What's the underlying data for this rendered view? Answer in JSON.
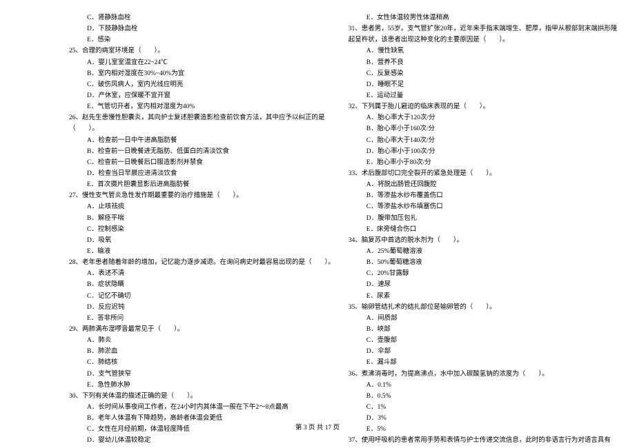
{
  "left_col": [
    {
      "type": "opt",
      "text": "C．肾静脉血栓"
    },
    {
      "type": "opt",
      "text": "D．下肢静脉血栓"
    },
    {
      "type": "opt",
      "text": "E．感染"
    },
    {
      "type": "q",
      "num": "25、",
      "text": "合理的病室环境是（　　）。"
    },
    {
      "type": "opt",
      "text": "A．婴儿室室温宜在22~24℃"
    },
    {
      "type": "opt",
      "text": "B．室内相对湿度在30%~40%为宜"
    },
    {
      "type": "opt",
      "text": "C．破伤风病人，室内光线应明亮"
    },
    {
      "type": "opt",
      "text": "D．产休室，应保暖不宜开窗"
    },
    {
      "type": "opt",
      "text": "E．气管切开者，室内相对湿度为40%"
    },
    {
      "type": "q",
      "num": "26、",
      "text": "赵先生患慢性胆囊炎，其向护士复述胆囊造影检查前饮食方法，其中应予以纠正的是"
    },
    {
      "type": "cont",
      "text": "（　　）。"
    },
    {
      "type": "opt",
      "text": "A．检查前一日中午进高脂肪餐"
    },
    {
      "type": "opt",
      "text": "B．检查前一日晚餐进无脂肪、低蛋白的清淡饮食"
    },
    {
      "type": "opt",
      "text": "C．检查前一日晚餐后口服造影剂并禁食"
    },
    {
      "type": "opt",
      "text": "D．检查当日早晨应进清淡饮食"
    },
    {
      "type": "opt",
      "text": "E．首次摄片胆囊显影后进高脂肪餐"
    },
    {
      "type": "q",
      "num": "27、",
      "text": "慢性支气管炎急性发作期最重要的治疗措施是（　　）。"
    },
    {
      "type": "opt",
      "text": "A．止咳祛痰"
    },
    {
      "type": "opt",
      "text": "B．解痉平喘"
    },
    {
      "type": "opt",
      "text": "C．控制感染"
    },
    {
      "type": "opt",
      "text": "D．吸氧"
    },
    {
      "type": "opt",
      "text": "E．输液"
    },
    {
      "type": "q",
      "num": "28、",
      "text": "老年患者随着年龄的增加，记忆能力逐步减退。在询问病史时最容易出现的是（　　）。"
    },
    {
      "type": "opt",
      "text": "A．表述不清"
    },
    {
      "type": "opt",
      "text": "B．症状隐瞒"
    },
    {
      "type": "opt",
      "text": "C．记忆不确切"
    },
    {
      "type": "opt",
      "text": "D．反应迟钝"
    },
    {
      "type": "opt",
      "text": "E．答非所问"
    },
    {
      "type": "q",
      "num": "29、",
      "text": "两肺满布湿啰音最常见于（　　）。"
    },
    {
      "type": "opt",
      "text": "A．肺炎"
    },
    {
      "type": "opt",
      "text": "B．肺淤血"
    },
    {
      "type": "opt",
      "text": "C．肺结核"
    },
    {
      "type": "opt",
      "text": "D．支气管狭窄"
    },
    {
      "type": "opt",
      "text": "E．急性肺水肿"
    },
    {
      "type": "q",
      "num": "30、",
      "text": "下列有关体温的描述正确的是（　　）。"
    },
    {
      "type": "opt",
      "text": "A．长时间从事夜间工作者，在24小时内其体温一般在下午2～8点最高"
    },
    {
      "type": "opt",
      "text": "B．老年人体温有下降趋势，高龄者体温会更低"
    },
    {
      "type": "opt",
      "text": "C．女性在月经前期，体温轻度降低"
    },
    {
      "type": "opt",
      "text": "D．婴幼儿体温较稳定"
    }
  ],
  "right_col": [
    {
      "type": "opt",
      "text": "E．女性体温较男性体温稍高"
    },
    {
      "type": "q",
      "num": "31、",
      "text": "患者男，55岁。支气管扩张20年，近年来手指末端增生、肥厚，指甲从根部到末端拱形隆"
    },
    {
      "type": "cont",
      "text": "起呈杵状，该患者出现这种变化的主要原因是（　　）。"
    },
    {
      "type": "opt",
      "text": "A．慢性缺氧"
    },
    {
      "type": "opt",
      "text": "B．营养不良"
    },
    {
      "type": "opt",
      "text": "C．反复感染"
    },
    {
      "type": "opt",
      "text": "D．睡眠不足"
    },
    {
      "type": "opt",
      "text": "E．运动过量"
    },
    {
      "type": "q",
      "num": "32、",
      "text": "下列属于胎儿窘迫的临床表现的是（　　）。"
    },
    {
      "type": "opt",
      "text": "A．胎心率大于120次/分"
    },
    {
      "type": "opt",
      "text": "B．胎心率小于160次/分"
    },
    {
      "type": "opt",
      "text": "C．胎心率大于140次/分"
    },
    {
      "type": "opt",
      "text": "D．胎心率小于100次/分"
    },
    {
      "type": "opt",
      "text": "E．胎心率小于80次/分"
    },
    {
      "type": "q",
      "num": "33、",
      "text": "术后腹部切口完全裂开的紧急处理是（　　）。"
    },
    {
      "type": "opt",
      "text": "A．将脱出肠管还回腹腔"
    },
    {
      "type": "opt",
      "text": "B．等渗盐水纱布覆盖伤口"
    },
    {
      "type": "opt",
      "text": "C．等渗盐水纱布填塞伤口"
    },
    {
      "type": "opt",
      "text": "D．腹带加压包扎"
    },
    {
      "type": "opt",
      "text": "E．床旁缝合伤口"
    },
    {
      "type": "q",
      "num": "34、",
      "text": "脑复苏中首选的脱水剂为（　　）。"
    },
    {
      "type": "opt",
      "text": "A．25%葡萄糖溶液"
    },
    {
      "type": "opt",
      "text": "B．50%葡萄糖溶液"
    },
    {
      "type": "opt",
      "text": "C．20%甘露醇"
    },
    {
      "type": "opt",
      "text": "D．速尿"
    },
    {
      "type": "opt",
      "text": "E．尿素"
    },
    {
      "type": "q",
      "num": "35、",
      "text": "输卵管结扎术的结扎部位是输卵管的（　　）。"
    },
    {
      "type": "opt",
      "text": "A．间质部"
    },
    {
      "type": "opt",
      "text": "B．峡部"
    },
    {
      "type": "opt",
      "text": "C．壶腹部"
    },
    {
      "type": "opt",
      "text": "D．伞部"
    },
    {
      "type": "opt",
      "text": "E．漏斗部"
    },
    {
      "type": "q",
      "num": "36、",
      "text": "煮沸消毒时，为提高沸点，水中加入碳酸氢钠的浓度为（　　）。"
    },
    {
      "type": "opt",
      "text": "A．0.1%"
    },
    {
      "type": "opt",
      "text": "B．0.5%"
    },
    {
      "type": "opt",
      "text": "C．1%"
    },
    {
      "type": "opt",
      "text": "D．3%"
    },
    {
      "type": "opt",
      "text": "E．5%"
    },
    {
      "type": "q",
      "num": "37、",
      "text": "使用呼吸机的患者常用手势和表情与护士传递交流信息，此时的非语言行为对语言具有"
    }
  ],
  "footer": "第 3 页 共 17 页"
}
